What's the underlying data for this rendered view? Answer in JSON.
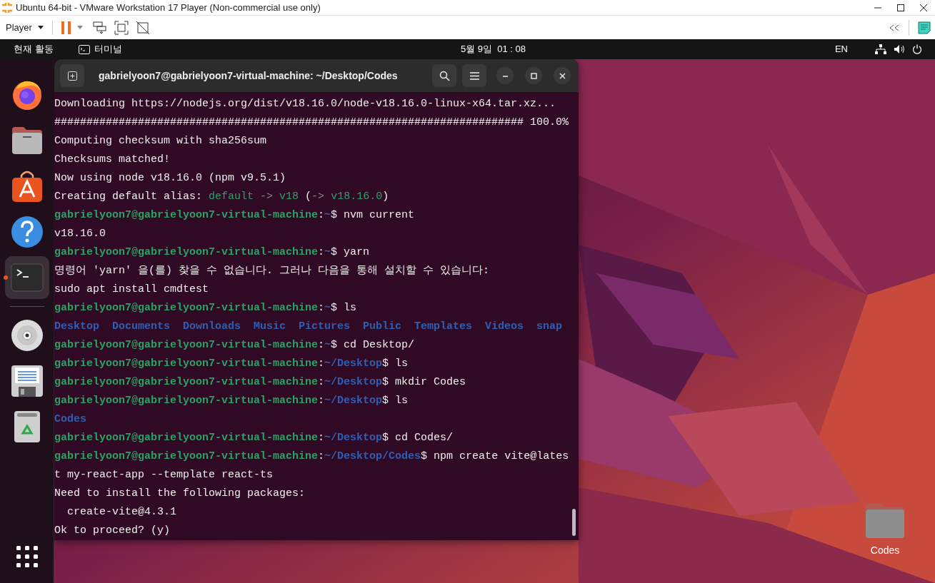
{
  "vmware": {
    "title": "Ubuntu 64-bit - VMware Workstation 17 Player (Non-commercial use only)",
    "menu": "Player"
  },
  "topbar": {
    "activities": "현재 활동",
    "app": "터미널",
    "clock": "5월 9일  01 : 08",
    "input": "EN"
  },
  "dock": {
    "groups": [
      [
        {
          "kind": "firefox",
          "selected": false,
          "running": false
        },
        {
          "kind": "files",
          "selected": false,
          "running": false
        },
        {
          "kind": "store",
          "selected": false,
          "running": false
        },
        {
          "kind": "help",
          "selected": false,
          "running": false
        },
        {
          "kind": "terminal",
          "selected": true,
          "running": true
        }
      ],
      [
        {
          "kind": "disc",
          "selected": false,
          "running": false
        },
        {
          "kind": "editor",
          "selected": false,
          "running": false
        },
        {
          "kind": "trash",
          "selected": false,
          "running": false
        }
      ]
    ]
  },
  "terminal": {
    "title": "gabrielyoon7@gabrielyoon7-virtual-machine: ~/Desktop/Codes",
    "lines": [
      [
        {
          "kind": "plain",
          "text": "Downloading https://nodejs.org/dist/v18.16.0/node-v18.16.0-linux-x64.tar.xz..."
        }
      ],
      [
        {
          "kind": "plain",
          "text": "######################################################################### 100.0%"
        }
      ],
      [
        {
          "kind": "plain",
          "text": "Computing checksum with sha256sum"
        }
      ],
      [
        {
          "kind": "plain",
          "text": "Checksums matched!"
        }
      ],
      [
        {
          "kind": "plain",
          "text": "Now using node v18.16.0 (npm v9.5.1)"
        }
      ],
      [
        {
          "kind": "plain",
          "text": "Creating default alias: "
        },
        {
          "kind": "value",
          "text": "default"
        },
        {
          "kind": "dim",
          "text": " -> "
        },
        {
          "kind": "value",
          "text": "v18"
        },
        {
          "kind": "plain",
          "text": " ("
        },
        {
          "kind": "dim",
          "text": "-> "
        },
        {
          "kind": "value",
          "text": "v18.16.0"
        },
        {
          "kind": "plain",
          "text": ")"
        }
      ],
      [
        {
          "kind": "user",
          "text": "gabrielyoon7@gabrielyoon7-virtual-machine"
        },
        {
          "kind": "plain",
          "text": ":"
        },
        {
          "kind": "path",
          "text": "~"
        },
        {
          "kind": "plain",
          "text": "$ nvm current"
        }
      ],
      [
        {
          "kind": "plain",
          "text": "v18.16.0"
        }
      ],
      [
        {
          "kind": "user",
          "text": "gabrielyoon7@gabrielyoon7-virtual-machine"
        },
        {
          "kind": "plain",
          "text": ":"
        },
        {
          "kind": "path",
          "text": "~"
        },
        {
          "kind": "plain",
          "text": "$ yarn"
        }
      ],
      [
        {
          "kind": "plain",
          "text": "명령어 'yarn' 을(를) 찾을 수 없습니다. 그러나 다음을 통해 설치할 수 있습니다:"
        }
      ],
      [
        {
          "kind": "plain",
          "text": "sudo apt install cmdtest"
        }
      ],
      [
        {
          "kind": "user",
          "text": "gabrielyoon7@gabrielyoon7-virtual-machine"
        },
        {
          "kind": "plain",
          "text": ":"
        },
        {
          "kind": "path",
          "text": "~"
        },
        {
          "kind": "plain",
          "text": "$ ls"
        }
      ],
      [
        {
          "kind": "dir",
          "text": "Desktop  Documents  Downloads  Music  Pictures  Public  Templates  Videos  snap"
        }
      ],
      [
        {
          "kind": "user",
          "text": "gabrielyoon7@gabrielyoon7-virtual-machine"
        },
        {
          "kind": "plain",
          "text": ":"
        },
        {
          "kind": "path",
          "text": "~"
        },
        {
          "kind": "plain",
          "text": "$ cd Desktop/"
        }
      ],
      [
        {
          "kind": "user",
          "text": "gabrielyoon7@gabrielyoon7-virtual-machine"
        },
        {
          "kind": "plain",
          "text": ":"
        },
        {
          "kind": "path",
          "text": "~/Desktop"
        },
        {
          "kind": "plain",
          "text": "$ ls"
        }
      ],
      [
        {
          "kind": "user",
          "text": "gabrielyoon7@gabrielyoon7-virtual-machine"
        },
        {
          "kind": "plain",
          "text": ":"
        },
        {
          "kind": "path",
          "text": "~/Desktop"
        },
        {
          "kind": "plain",
          "text": "$ mkdir Codes"
        }
      ],
      [
        {
          "kind": "user",
          "text": "gabrielyoon7@gabrielyoon7-virtual-machine"
        },
        {
          "kind": "plain",
          "text": ":"
        },
        {
          "kind": "path",
          "text": "~/Desktop"
        },
        {
          "kind": "plain",
          "text": "$ ls"
        }
      ],
      [
        {
          "kind": "dir",
          "text": "Codes"
        }
      ],
      [
        {
          "kind": "user",
          "text": "gabrielyoon7@gabrielyoon7-virtual-machine"
        },
        {
          "kind": "plain",
          "text": ":"
        },
        {
          "kind": "path",
          "text": "~/Desktop"
        },
        {
          "kind": "plain",
          "text": "$ cd Codes/"
        }
      ],
      [
        {
          "kind": "user",
          "text": "gabrielyoon7@gabrielyoon7-virtual-machine"
        },
        {
          "kind": "plain",
          "text": ":"
        },
        {
          "kind": "path",
          "text": "~/Desktop/Codes"
        },
        {
          "kind": "plain",
          "text": "$ npm create vite@lates"
        }
      ],
      [
        {
          "kind": "plain",
          "text": "t my-react-app --template react-ts"
        }
      ],
      [
        {
          "kind": "plain",
          "text": "Need to install the following packages:"
        }
      ],
      [
        {
          "kind": "plain",
          "text": "  create-vite@4.3.1"
        }
      ],
      [
        {
          "kind": "plain",
          "text": "Ok to proceed? (y)"
        }
      ]
    ]
  },
  "desktop_icons": [
    {
      "label": "Codes"
    }
  ]
}
